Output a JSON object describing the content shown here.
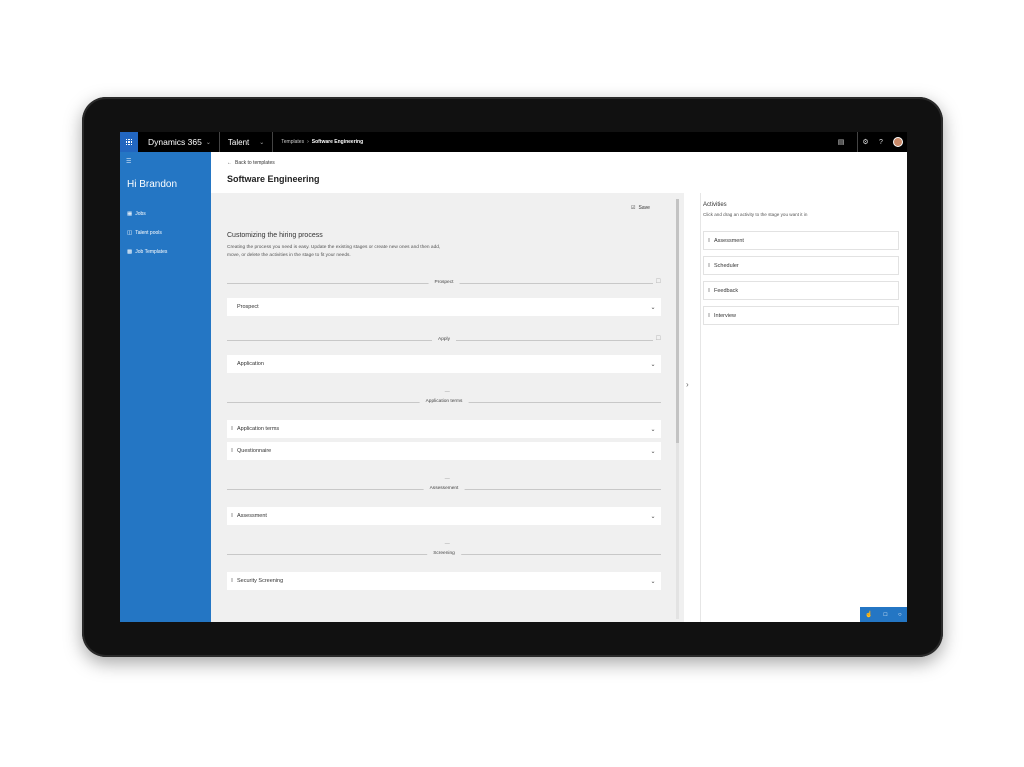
{
  "topbar": {
    "brand": "Dynamics 365",
    "app": "Talent",
    "breadcrumb": [
      "Templates",
      "Software Engineering"
    ],
    "icons": [
      "waffle-icon",
      "chevron-down-icon",
      "book-icon",
      "gear-icon",
      "help-icon",
      "avatar"
    ]
  },
  "nav": {
    "greeting": "Hi Brandon",
    "items": [
      {
        "label": "Jobs",
        "icon": "jobs-icon"
      },
      {
        "label": "Talent pools",
        "icon": "talent-pools-icon"
      },
      {
        "label": "Job Templates",
        "icon": "job-templates-icon"
      }
    ]
  },
  "header": {
    "back_label": "Back to templates",
    "title": "Software Engineering"
  },
  "main": {
    "save_label": "Save",
    "section_title": "Customizing the hiring process",
    "section_desc": "Creating the process you need is easy. Update the existing stages or create new ones and then add, move, or delete the activities in the stage to fit your needs.",
    "stages": [
      {
        "label": "Prospect",
        "locked": true,
        "activities": [
          "Prospect"
        ]
      },
      {
        "label": "Apply",
        "locked": true,
        "activities": [
          "Application"
        ]
      },
      {
        "label": "Application terms",
        "locked": false,
        "activities": [
          "Application terms",
          "Questionnaire"
        ]
      },
      {
        "label": "Assessement",
        "locked": false,
        "activities": [
          "Assessment"
        ]
      },
      {
        "label": "Screening",
        "locked": false,
        "activities": [
          "Security Screening"
        ]
      }
    ]
  },
  "activities": {
    "title": "Activities",
    "subtitle": "Click and drag an activity to the stage you want it in",
    "items": [
      "Assessment",
      "Scheduler",
      "Feedback",
      "Interview"
    ]
  },
  "colors": {
    "accent": "#2476c4",
    "topbar": "#000000",
    "canvas": "#f0f0f0"
  }
}
